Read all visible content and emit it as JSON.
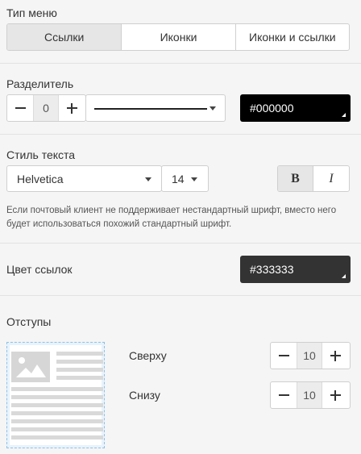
{
  "menu_type": {
    "label": "Тип меню",
    "options": [
      "Ссылки",
      "Иконки",
      "Иконки и ссылки"
    ],
    "selected": "Ссылки"
  },
  "separator": {
    "label": "Разделитель",
    "value": "0",
    "line_style": "solid",
    "color": "#000000"
  },
  "text_style": {
    "label": "Стиль текста",
    "font": "Helvetica",
    "size": "14",
    "bold_label": "B",
    "italic_label": "I",
    "bold_active": true,
    "note": "Если почтовый клиент не поддерживает нестандартный шрифт, вместо него будет использоваться похожий стандартный шрифт."
  },
  "link_color": {
    "label": "Цвет ссылок",
    "color": "#333333"
  },
  "padding": {
    "label": "Отступы",
    "top_label": "Сверху",
    "top_value": "10",
    "bottom_label": "Снизу",
    "bottom_value": "10"
  },
  "icons": {
    "minus": "minus-icon",
    "plus": "plus-icon",
    "caret": "chevron-down-icon",
    "image": "image-placeholder-icon"
  }
}
